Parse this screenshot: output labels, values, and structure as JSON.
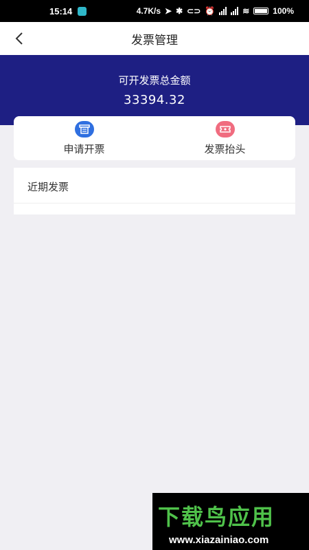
{
  "status_bar": {
    "time": "15:14",
    "net_speed": "4.7K/s",
    "battery": "100%"
  },
  "header": {
    "title": "发票管理"
  },
  "summary": {
    "label": "可开发票总金额",
    "amount": "33394.32"
  },
  "actions": [
    {
      "label": "申请开票",
      "icon": "invoice-icon",
      "color": "#2f6fe0"
    },
    {
      "label": "发票抬头",
      "icon": "ticket-icon",
      "color": "#f06c7f"
    }
  ],
  "recent": {
    "title": "近期发票"
  },
  "watermark": {
    "brand": "下载鸟应用",
    "url": "www.xiazainiao.com"
  },
  "colors": {
    "banner": "#1e1f83",
    "background": "#f0eff3",
    "watermark_green": "#4fc14a"
  }
}
